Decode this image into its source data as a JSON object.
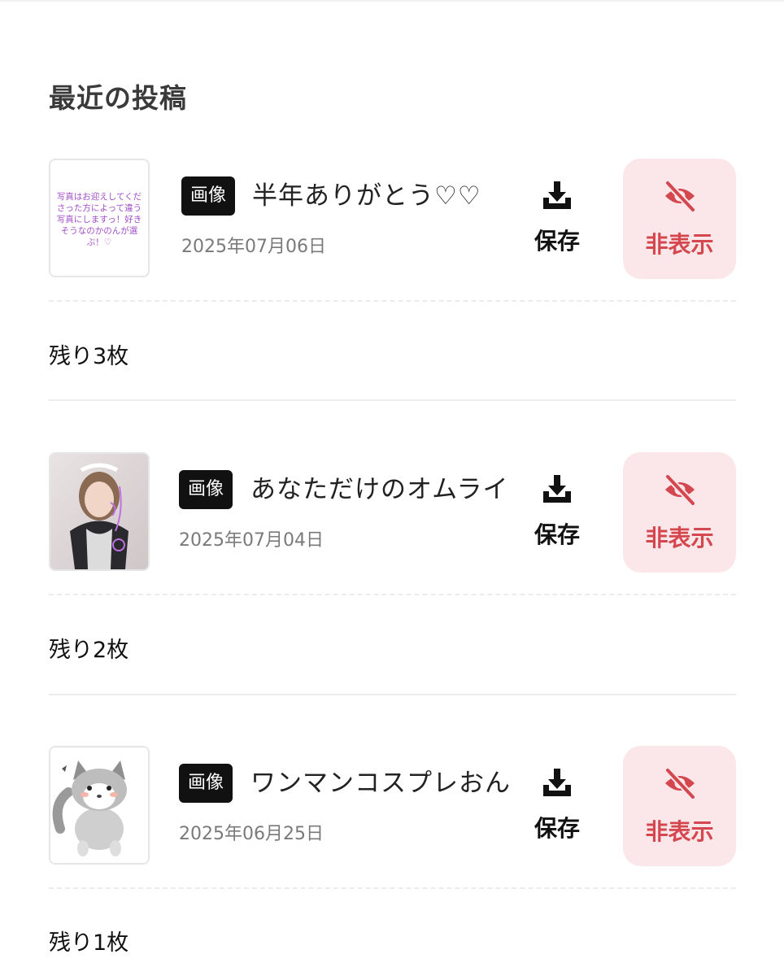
{
  "section_title": "最近の投稿",
  "posts": [
    {
      "type_label": "画像",
      "title": "半年ありがとう♡♡",
      "date": "2025年07月06日",
      "save_label": "保存",
      "hide_label": "非表示",
      "thumbnail_text": "写真はお迎えしてくださった方によって違う写真にしますっ！好きそうなのかのんが選ぶ！♡",
      "remaining": "残り3枚"
    },
    {
      "type_label": "画像",
      "title": "あなただけのオムライ",
      "date": "2025年07月04日",
      "save_label": "保存",
      "hide_label": "非表示",
      "remaining": "残り2枚"
    },
    {
      "type_label": "画像",
      "title": "ワンマンコスプレおん",
      "date": "2025年06月25日",
      "save_label": "保存",
      "hide_label": "非表示",
      "remaining": "残り1枚"
    }
  ],
  "colors": {
    "hide_bg": "#fbe7e9",
    "hide_text": "#d4474f",
    "badge_bg": "#111111",
    "thumb_text": "#a24fc9"
  },
  "icons": {
    "save": "download-tray-icon",
    "hide": "eye-slash-icon"
  }
}
